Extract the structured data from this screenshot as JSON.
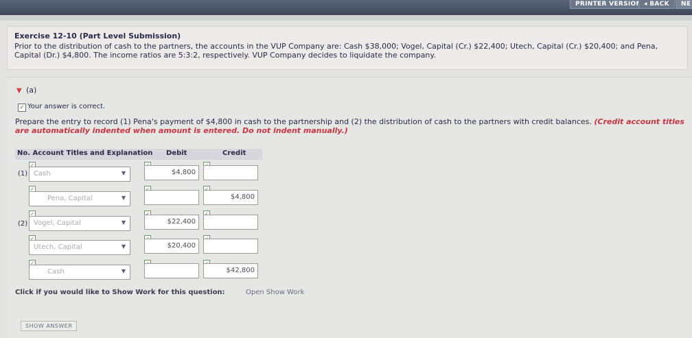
{
  "topbar": {
    "printer_label": "PRINTER VERSION",
    "back_label": "◂ BACK",
    "next_label": "NE"
  },
  "exercise": {
    "title": "Exercise 12-10 (Part Level Submission)",
    "text": "Prior to the distribution of cash to the partners, the accounts in the VUP Company are: Cash $38,000; Vogel, Capital (Cr.) $22,400; Utech, Capital (Cr.) $20,400; and Pena, Capital (Dr.) $4,800. The income ratios are 5:3:2, respectively. VUP Company decides to liquidate the company."
  },
  "part": {
    "label": "(a)"
  },
  "feedback": {
    "correct": "Your answer is correct."
  },
  "instructions": {
    "main": "Prepare the entry to record (1) Pena's payment of $4,800 in cash to the partnership and (2) the distribution of cash to the partners with credit balances.",
    "note": "(Credit account titles are automatically indented when amount is entered. Do not indent manually.)"
  },
  "table": {
    "headers": {
      "no": "No.",
      "account": "Account Titles and Explanation",
      "debit": "Debit",
      "credit": "Credit"
    },
    "rows": [
      {
        "no": "(1)",
        "account": "Cash",
        "debit": "$4,800",
        "credit": ""
      },
      {
        "no": "",
        "account": "Pena, Capital",
        "debit": "",
        "credit": "$4,800"
      },
      {
        "no": "(2)",
        "account": "Vogel, Capital",
        "debit": "$22,400",
        "credit": ""
      },
      {
        "no": "",
        "account": "Utech, Capital",
        "debit": "$20,400",
        "credit": ""
      },
      {
        "no": "",
        "account": "Cash",
        "debit": "",
        "credit": "$42,800"
      }
    ]
  },
  "show_work": {
    "prompt": "Click if you would like to Show Work for this question:",
    "link": "Open Show Work"
  },
  "show_answer": "SHOW ANSWER"
}
